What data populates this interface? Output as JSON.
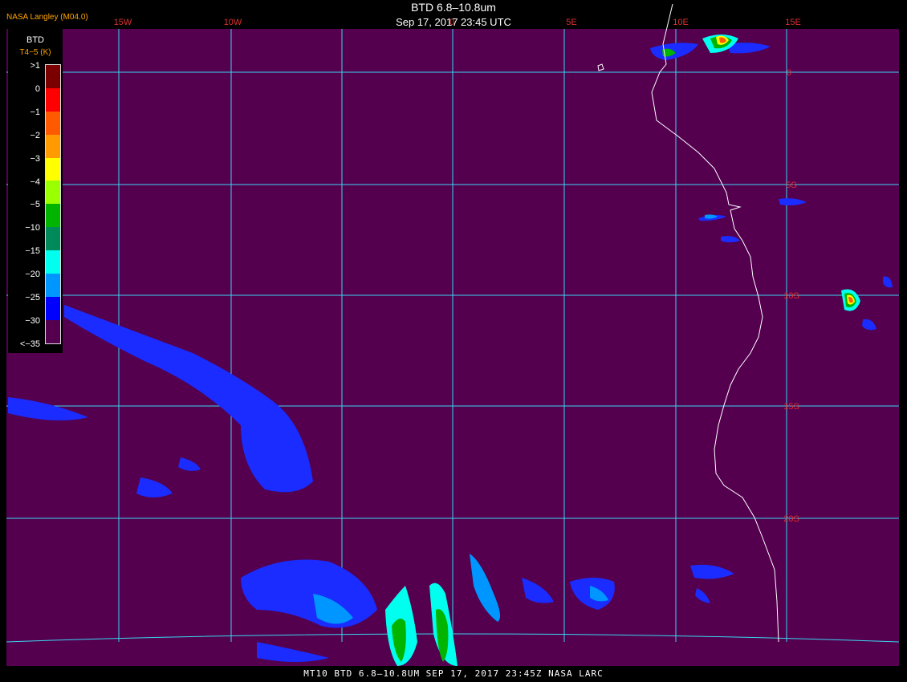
{
  "header": {
    "org": "NASA Langley (M04.0)",
    "title": "BTD 6.8–10.8um",
    "datetime": "Sep 17, 2017 23:45 UTC"
  },
  "map": {
    "background_color": "#54004f",
    "grid_color": "#3ad6f0",
    "coast_color": "#ffffff",
    "label_color": "#e03030",
    "lon_labels_top": [
      "15W",
      "10W",
      "0",
      "5E",
      "10E",
      "15E"
    ],
    "lat_labels": [
      "0",
      "5S",
      "10S",
      "15S",
      "20S"
    ]
  },
  "legend": {
    "title": "BTD",
    "subtitle": "T4−5 (K)",
    "labels": [
      ">1",
      "0",
      "−1",
      "−2",
      "−3",
      "−4",
      "−5",
      "−10",
      "−15",
      "−20",
      "−25",
      "−30",
      "<−35"
    ],
    "colors": [
      "#7a0000",
      "#ff0000",
      "#ff5a00",
      "#ff9a00",
      "#ffff00",
      "#9aff00",
      "#00b400",
      "#008a5a",
      "#00ffee",
      "#0096ff",
      "#0000ff",
      "#54004f"
    ]
  },
  "footer": {
    "text": "MT10  BTD 6.8–10.8UM  SEP 17, 2017 23:45Z  NASA LARC"
  }
}
